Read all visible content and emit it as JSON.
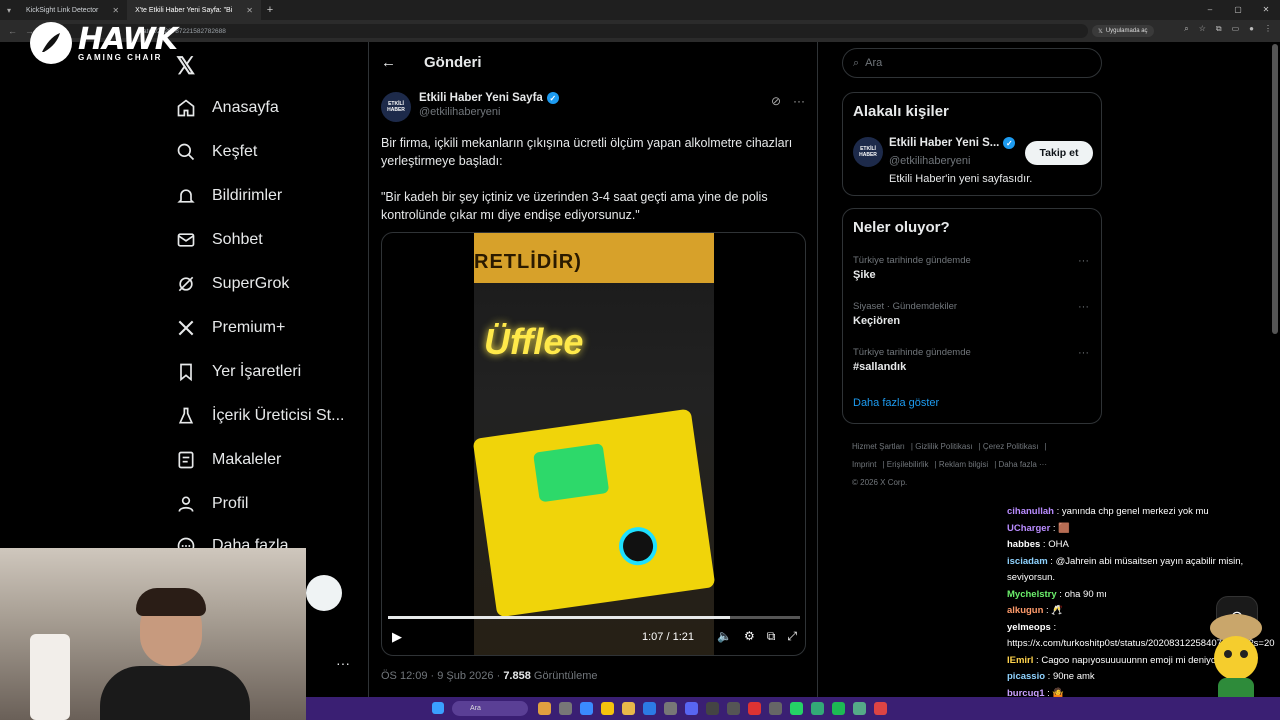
{
  "browser": {
    "tabs": [
      {
        "title": "KickSight Link Detector",
        "active": false
      },
      {
        "title": "X'te Etkili Haber Yeni Sayfa: \"Bi",
        "active": true
      }
    ],
    "url": "status/2020787221582782688",
    "app_button": "Uygulamada aç"
  },
  "overlay_logo": {
    "brand": "HAWK",
    "tagline": "GAMING CHAIR"
  },
  "nav": {
    "items": [
      {
        "label": "Anasayfa",
        "icon": "home-icon"
      },
      {
        "label": "Keşfet",
        "icon": "search-icon"
      },
      {
        "label": "Bildirimler",
        "icon": "bell-icon"
      },
      {
        "label": "Sohbet",
        "icon": "mail-icon"
      },
      {
        "label": "SuperGrok",
        "icon": "grok-icon"
      },
      {
        "label": "Premium+",
        "icon": "x-icon"
      },
      {
        "label": "Yer İşaretleri",
        "icon": "bookmark-icon"
      },
      {
        "label": "İçerik Üreticisi St...",
        "icon": "flask-icon"
      },
      {
        "label": "Makaleler",
        "icon": "article-icon"
      },
      {
        "label": "Profil",
        "icon": "person-icon"
      },
      {
        "label": "Daha fazla",
        "icon": "more-icon"
      }
    ]
  },
  "post": {
    "header": "Gönderi",
    "author_name": "Etkili Haber Yeni Sayfa",
    "author_handle": "@etkilihaberyeni",
    "avatar_text": "ETKİLİ HABER",
    "text_1": "Bir firma, içkili mekanların çıkışına ücretli ölçüm yapan alkolmetre cihazları yerleştirmeye başladı:",
    "text_2": "\"Bir kadeh bir şey içtiniz ve üzerinden 3-4 saat geçti ama yine de polis kontrolünde çıkar mı diye endişe ediyorsunuz.\"",
    "video": {
      "sign_text": "RETLİDİR)",
      "brand": "Üfflee",
      "time": "1:07 / 1:21",
      "progress_fraction": 0.83
    },
    "meta_time": "ÖS 12:09 · 9 Şub 2026 · ",
    "views": "7.858",
    "views_label": " Görüntüleme"
  },
  "right": {
    "search_placeholder": "Ara",
    "related_title": "Alakalı kişiler",
    "related_person": {
      "name": "Etkili Haber Yeni S...",
      "handle": "@etkilihaberyeni",
      "bio": "Etkili Haber'in yeni sayfasıdır.",
      "follow": "Takip et"
    },
    "trends_title": "Neler oluyor?",
    "trends": [
      {
        "category": "Türkiye tarihinde gündemde",
        "name": "Şike"
      },
      {
        "category": "Siyaset · Gündemdekiler",
        "name": "Keçiören"
      },
      {
        "category": "Türkiye tarihinde gündemde",
        "name": "#sallandık"
      }
    ],
    "show_more": "Daha fazla göster",
    "footer": [
      "Hizmet Şartları",
      "Gizlilik Politikası",
      "Çerez Politikası",
      "Imprint",
      "Erişilebilirlik",
      "Reklam bilgisi",
      "Daha fazla ···",
      "© 2026 X Corp."
    ]
  },
  "chat": [
    {
      "user": "cihanullah",
      "color": "#b98cff",
      "msg": "yanında chp genel merkezi yok mu"
    },
    {
      "user": "UCharger",
      "color": "#b98cff",
      "msg": "🟫"
    },
    {
      "user": "habbes",
      "color": "#ffffff",
      "msg": "OHA"
    },
    {
      "user": "isciadam",
      "color": "#8fd3ff",
      "msg": "@Jahrein abi müsaitsen yayın açabilir misin, seviyorsun."
    },
    {
      "user": "Mychelstry",
      "color": "#6cf06c",
      "msg": "oha 90 mı"
    },
    {
      "user": "alkugun",
      "color": "#ff9b6b",
      "msg": "🥂"
    },
    {
      "user": "yelmeops",
      "color": "#ffffff",
      "msg": "https://x.com/turkoshitp0st/status/2020831225840732798?s=20"
    },
    {
      "user": "IEmirl",
      "color": "#ffd34d",
      "msg": "Cagoo napıyosuuuuunnn emoji mi deniyosuuuuun"
    },
    {
      "user": "picassio",
      "color": "#8fd3ff",
      "msg": "90ne amk"
    },
    {
      "user": "burcuq1",
      "color": "#c9a0ff",
      "msg": "🤷"
    }
  ],
  "taskbar": {
    "search": "Ara"
  }
}
